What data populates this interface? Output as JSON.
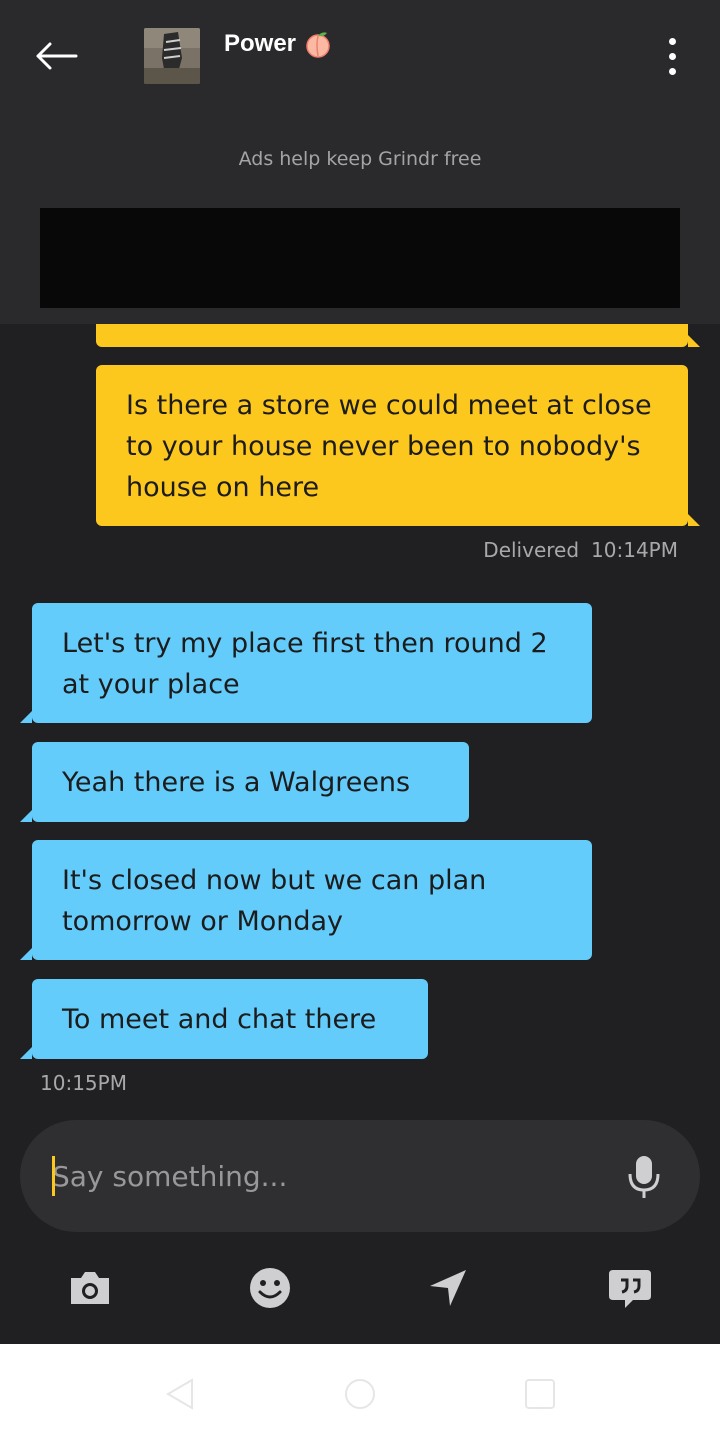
{
  "header": {
    "contact_name": "Power",
    "ads_text": "Ads help keep Grindr free"
  },
  "messages": [
    {
      "direction": "outgoing",
      "text": "Is there a store we could meet at close to your house never been to nobody's house on here"
    },
    {
      "direction": "incoming",
      "text": "Let's try my place first then round 2 at your place"
    },
    {
      "direction": "incoming",
      "text": "Yeah there is a Walgreens"
    },
    {
      "direction": "incoming",
      "text": "It's closed now but we can plan tomorrow or Monday"
    },
    {
      "direction": "incoming",
      "text": "To meet and chat there"
    }
  ],
  "status": {
    "delivered_label": "Delivered",
    "delivered_time": "10:14PM",
    "incoming_time": "10:15PM"
  },
  "composer": {
    "placeholder": "Say something..."
  },
  "colors": {
    "outgoing_bubble": "#fdc81e",
    "incoming_bubble": "#63ccfb",
    "background": "#202022",
    "header": "#2a2a2c"
  },
  "icons": {
    "back": "arrow-left-icon",
    "more": "more-vertical-icon",
    "mic": "microphone-icon",
    "camera": "camera-icon",
    "emoji": "smiley-icon",
    "location": "location-arrow-icon",
    "quick_replies": "quote-bubble-icon"
  }
}
